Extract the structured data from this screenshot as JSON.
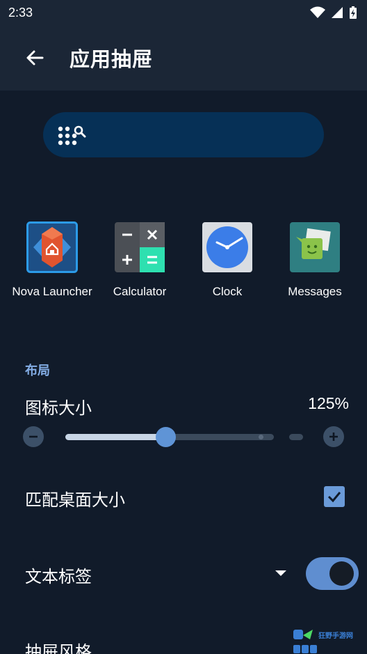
{
  "status_bar": {
    "time": "2:33",
    "icons": [
      "wifi-icon",
      "signal-icon",
      "battery-charging-icon"
    ]
  },
  "app_bar": {
    "title": "应用抽屉",
    "back_icon": "arrow-left-icon"
  },
  "search": {
    "icon": "dots-search-icon"
  },
  "apps": [
    {
      "label": "Nova Launcher",
      "icon": "nova-launcher-icon"
    },
    {
      "label": "Calculator",
      "icon": "calculator-icon"
    },
    {
      "label": "Clock",
      "icon": "clock-icon"
    },
    {
      "label": "Messages",
      "icon": "messages-icon"
    }
  ],
  "layout_section": {
    "header": "布局",
    "icon_size": {
      "label": "图标大小",
      "value_text": "125%",
      "slider_fraction": 0.48
    },
    "match_desktop": {
      "label": "匹配桌面大小",
      "checked": true
    },
    "text_labels": {
      "label": "文本标签",
      "enabled": true
    },
    "drawer_style": {
      "label": "抽屉风格"
    }
  },
  "watermark": {
    "text": "狂野手游网"
  },
  "colors": {
    "background": "#111b2a",
    "app_bar": "#1b2636",
    "accent": "#5f94d6",
    "section_header": "#84aee6",
    "search_bg": "#063056"
  }
}
